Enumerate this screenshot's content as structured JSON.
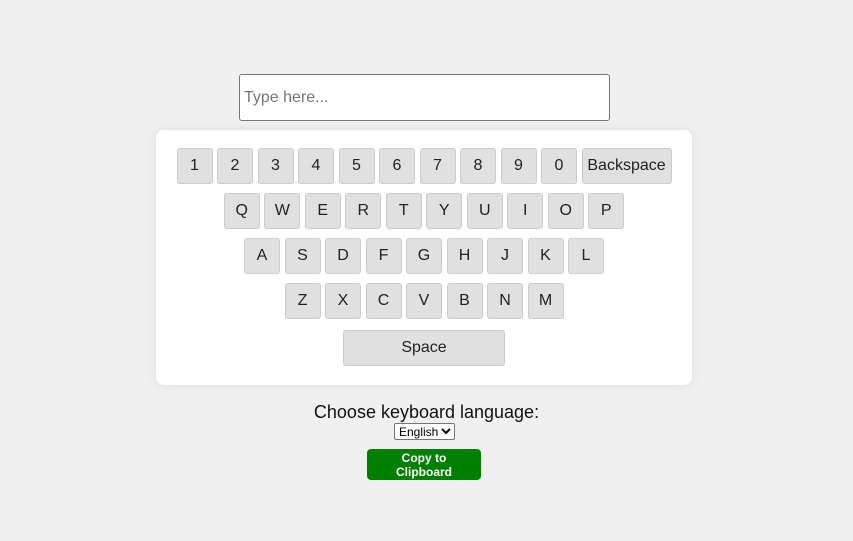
{
  "input": {
    "placeholder": "Type here...",
    "value": ""
  },
  "keyboard": {
    "rows": [
      [
        "1",
        "2",
        "3",
        "4",
        "5",
        "6",
        "7",
        "8",
        "9",
        "0",
        "Backspace"
      ],
      [
        "Q",
        "W",
        "E",
        "R",
        "T",
        "Y",
        "U",
        "I",
        "O",
        "P"
      ],
      [
        "A",
        "S",
        "D",
        "F",
        "G",
        "H",
        "J",
        "K",
        "L"
      ],
      [
        "Z",
        "X",
        "C",
        "V",
        "B",
        "N",
        "M"
      ],
      [
        "Space"
      ]
    ]
  },
  "language": {
    "label": "Choose keyboard language:",
    "selected": "English"
  },
  "actions": {
    "copy_label": "Copy to Clipboard"
  },
  "colors": {
    "background": "#f0f0f0",
    "key_background": "#e0e0e0",
    "copy_button": "#008000"
  }
}
